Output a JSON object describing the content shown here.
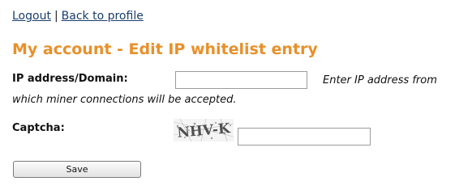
{
  "nav": {
    "logout": "Logout",
    "separator": "|",
    "back_to_profile": "Back to profile"
  },
  "page": {
    "title": "My account - Edit IP whitelist entry"
  },
  "form": {
    "ip_label": "IP address/Domain:",
    "ip_value": "",
    "ip_hint_line1": "Enter IP address from",
    "ip_hint_line2": "which miner connections will be accepted.",
    "captcha_label": "Captcha:",
    "captcha_image_text": "NHV-K",
    "captcha_value": "",
    "save_label": "Save"
  },
  "colors": {
    "title": "#e8902a",
    "link": "#1a3e6e"
  }
}
